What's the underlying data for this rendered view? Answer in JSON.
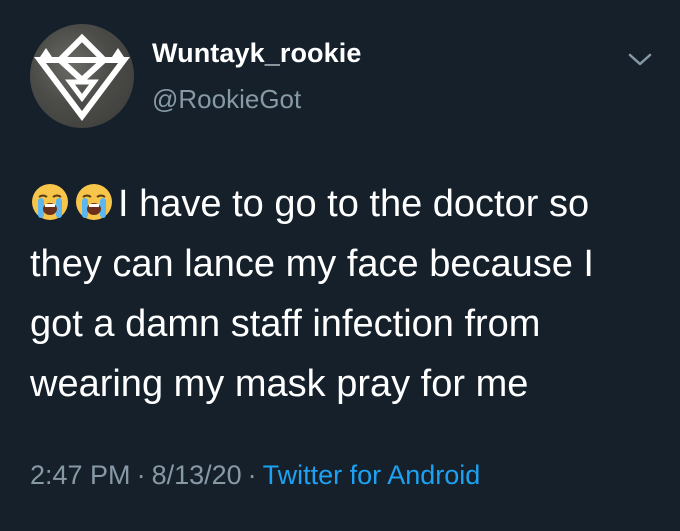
{
  "user": {
    "display_name": "Wuntayk_rookie",
    "handle": "@RookieGot",
    "avatar_icon": "triangle-logo-icon"
  },
  "menu": {
    "icon": "chevron-down-icon"
  },
  "tweet": {
    "emojis": [
      "loudly-crying-face-emoji",
      "loudly-crying-face-emoji"
    ],
    "lines": [
      "I have to go to the doctor so",
      "they can lance my face because I",
      "got a damn staff infection from",
      "wearing my mask pray for me"
    ]
  },
  "meta": {
    "time": "2:47 PM",
    "date": "8/13/20",
    "separator": "·",
    "source": "Twitter for Android"
  },
  "colors": {
    "background": "#15202b",
    "primary_text": "#ffffff",
    "secondary_text": "#8899a6",
    "link": "#1da1f2"
  }
}
